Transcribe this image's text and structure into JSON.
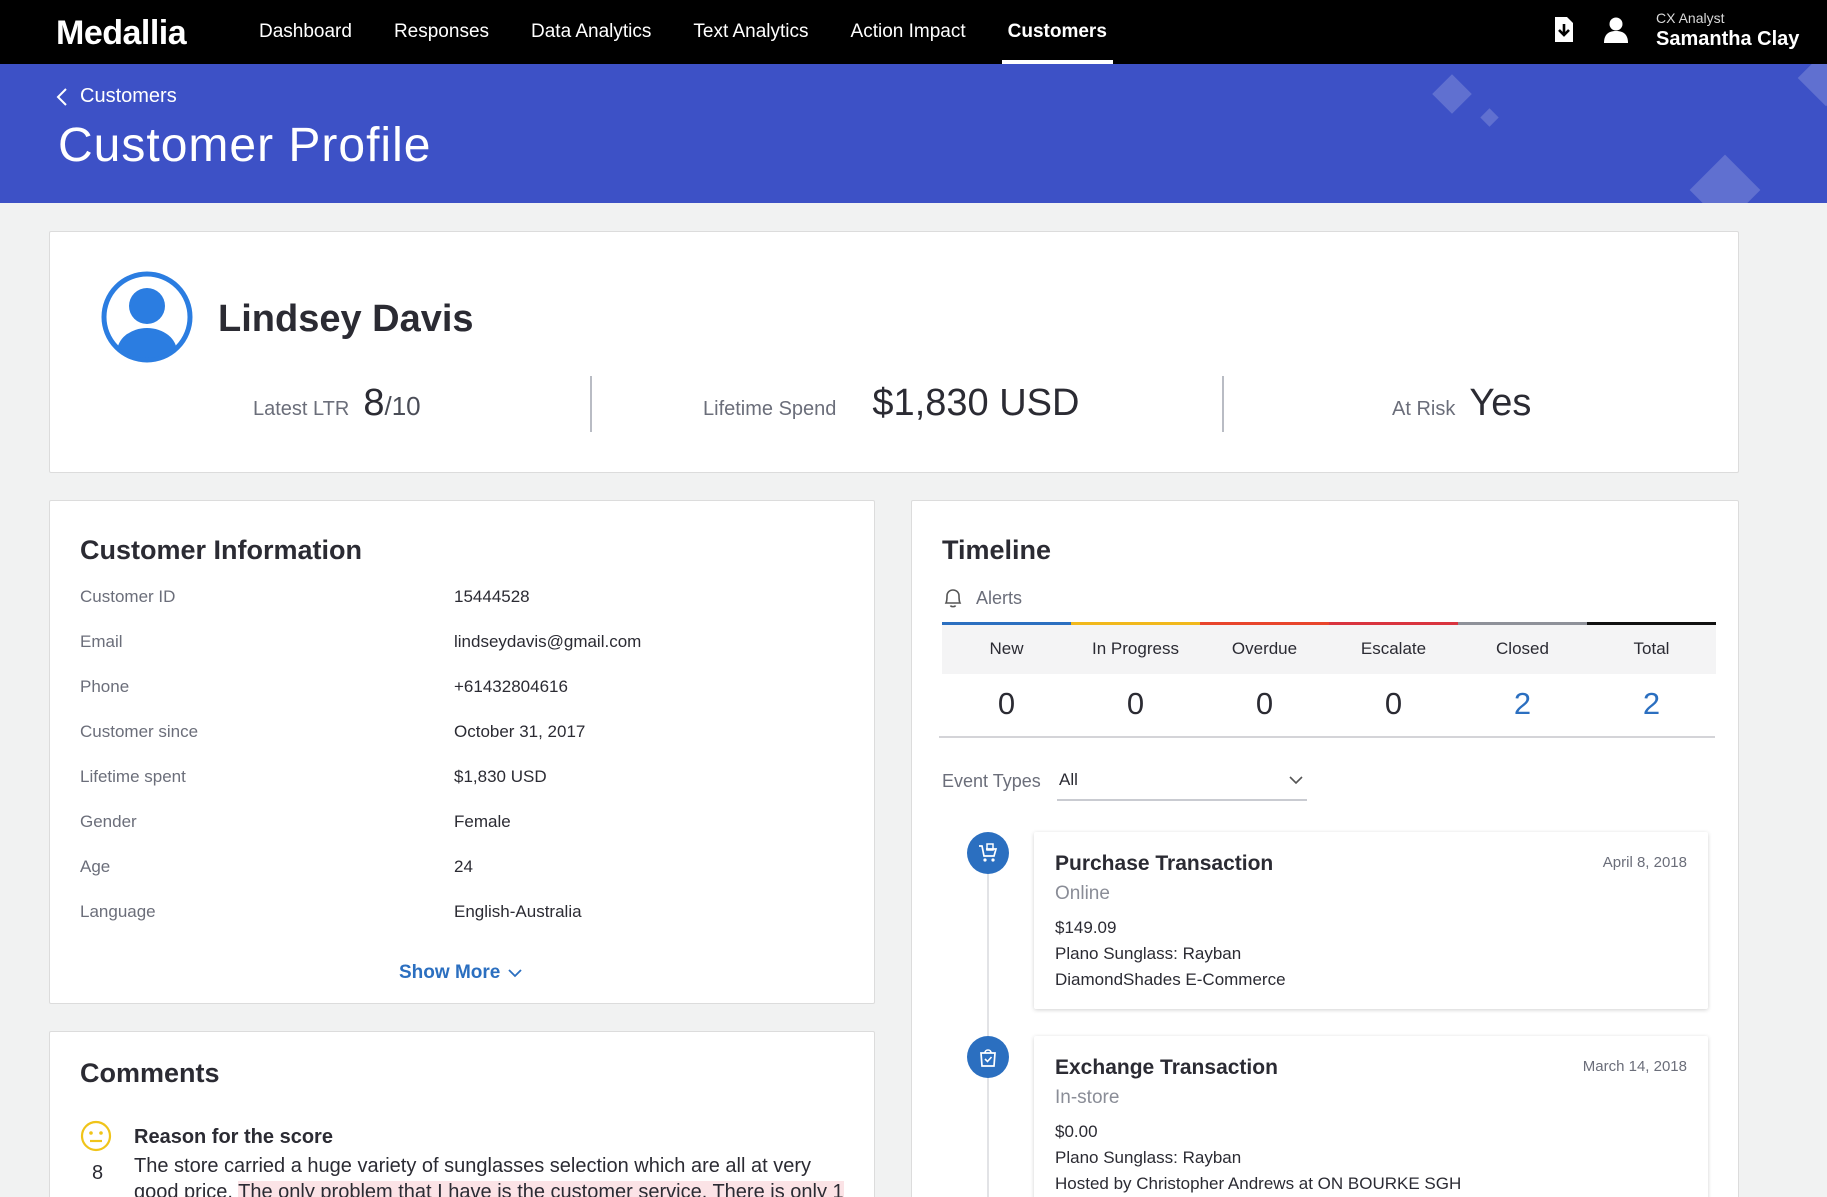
{
  "brand": {
    "logo_text": "Medallia",
    "accent": "#3d51c6",
    "link": "#2b6fc0"
  },
  "nav": {
    "items": [
      {
        "label": "Dashboard",
        "active": false
      },
      {
        "label": "Responses",
        "active": false
      },
      {
        "label": "Data Analytics",
        "active": false
      },
      {
        "label": "Text Analytics",
        "active": false
      },
      {
        "label": "Action Impact",
        "active": false
      },
      {
        "label": "Customers",
        "active": true
      }
    ],
    "icons": [
      "download-icon",
      "user-icon"
    ],
    "user": {
      "role": "CX Analyst",
      "name": "Samantha Clay"
    }
  },
  "header": {
    "breadcrumb": "Customers",
    "title": "Customer Profile"
  },
  "profile": {
    "name": "Lindsey Davis",
    "kpis": {
      "ltr": {
        "label": "Latest LTR",
        "value": "8",
        "suffix": "/10"
      },
      "spend": {
        "label": "Lifetime Spend",
        "value": "$1,830 USD"
      },
      "risk": {
        "label": "At Risk",
        "value": "Yes"
      }
    }
  },
  "customer_info": {
    "title": "Customer Information",
    "rows": [
      {
        "label": "Customer ID",
        "value": "15444528"
      },
      {
        "label": "Email",
        "value": "lindseydavis@gmail.com"
      },
      {
        "label": "Phone",
        "value": "+61432804616"
      },
      {
        "label": "Customer since",
        "value": "October 31, 2017"
      },
      {
        "label": "Lifetime spent",
        "value": "$1,830 USD"
      },
      {
        "label": "Gender",
        "value": "Female"
      },
      {
        "label": "Age",
        "value": "24"
      },
      {
        "label": "Language",
        "value": "English-Australia"
      }
    ],
    "show_more": "Show More"
  },
  "comments": {
    "title": "Comments",
    "score": "8",
    "reason_title": "Reason for the score",
    "text_plain": "The store carried a huge variety of sunglasses selection which are all at very good price. ",
    "text_highlight": "The only problem that I have is the customer service. There is only 1"
  },
  "timeline": {
    "title": "Timeline",
    "alerts_label": "Alerts",
    "statuses": [
      {
        "label": "New",
        "value": "0",
        "color": "#2b6fc0"
      },
      {
        "label": "In Progress",
        "value": "0",
        "color": "#f1b81c"
      },
      {
        "label": "Overdue",
        "value": "0",
        "color": "#e8452c"
      },
      {
        "label": "Escalate",
        "value": "0",
        "color": "#d9343f"
      },
      {
        "label": "Closed",
        "value": "2",
        "color": "#8e9199"
      },
      {
        "label": "Total",
        "value": "2",
        "color": "#111111"
      }
    ],
    "event_types_label": "Event Types",
    "event_types_value": "All",
    "events": [
      {
        "title": "Purchase Transaction",
        "channel": "Online",
        "date": "April 8, 2018",
        "lines": [
          "$149.09",
          "Plano Sunglass: Rayban",
          "DiamondShades E-Commerce"
        ],
        "icon": "shopping-cart-icon"
      },
      {
        "title": "Exchange Transaction",
        "channel": "In-store",
        "date": "March 14, 2018",
        "lines": [
          "$0.00",
          "Plano Sunglass: Rayban",
          "Hosted by Christopher Andrews at ON BOURKE SGH"
        ],
        "icon": "shopping-bag-icon"
      }
    ]
  }
}
